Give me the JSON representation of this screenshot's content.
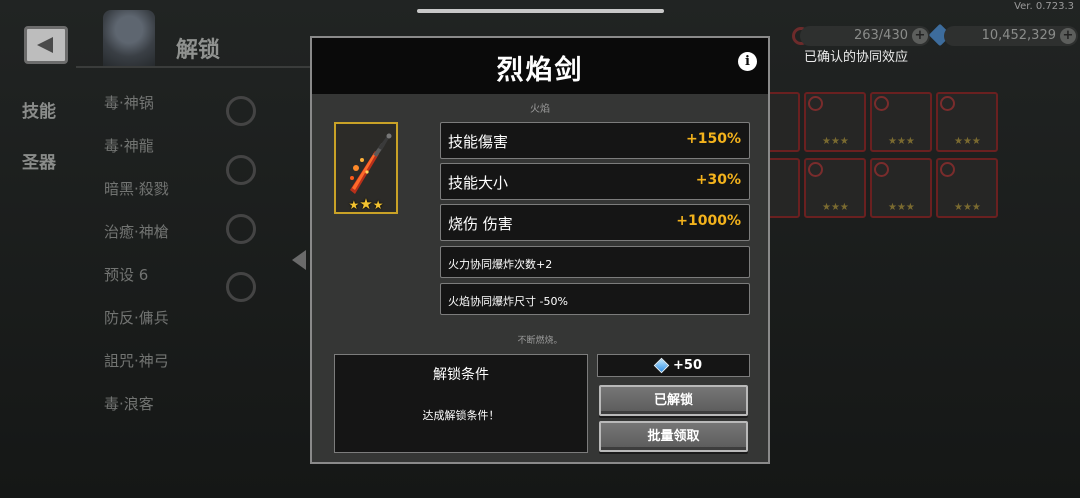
{
  "version": "Ver. 0.723.3",
  "background": {
    "unlock_tab": "解锁",
    "left_tabs": [
      "技能",
      "圣器"
    ],
    "presets": [
      "毒·神锅",
      "毒·神龍",
      "暗黑·殺戮",
      "治癒·神槍",
      "预设 6",
      "防反·傭兵",
      "詛咒·神弓",
      "毒·浪客"
    ],
    "energy": "263/430",
    "gems": "10,452,329",
    "synergy_title": "已确认的协同效应"
  },
  "modal": {
    "title": "烈焰剑",
    "info_glyph": "i",
    "category": "火焰",
    "item_stars": 3,
    "stats": [
      {
        "label": "技能傷害",
        "value": "+150%"
      },
      {
        "label": "技能大小",
        "value": "+30%"
      },
      {
        "label": "烧伤 伤害",
        "value": "+1000%"
      }
    ],
    "notes": [
      "火力协同爆炸次数+2",
      "火焰协同爆炸尺寸 -50%"
    ],
    "flavor": "不断燃烧。",
    "condition_title": "解锁条件",
    "condition_text": "达成解锁条件！",
    "reward": "+50",
    "btn_unlocked": "已解锁",
    "btn_claim": "批量领取"
  },
  "colors": {
    "accent_gold": "#f3b21c",
    "frame_gold": "#c9a227",
    "slot_red": "#6a2020",
    "gem_blue": "#2f8fe8"
  },
  "icons": {
    "back": "back-arrow-icon",
    "info": "info-icon",
    "gem": "gem-icon",
    "star": "star-icon"
  }
}
